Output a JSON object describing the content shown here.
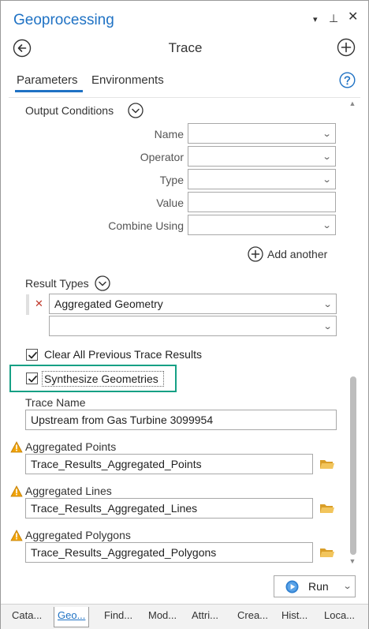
{
  "pane": {
    "title": "Geoprocessing",
    "menu_glyph": "▾",
    "pin_glyph": "⊥",
    "close_glyph": "✕"
  },
  "tool": {
    "title": "Trace"
  },
  "tabs": {
    "parameters": "Parameters",
    "environments": "Environments"
  },
  "output_conditions": {
    "label": "Output Conditions",
    "rows": {
      "name": {
        "label": "Name",
        "value": ""
      },
      "operator": {
        "label": "Operator",
        "value": ""
      },
      "type": {
        "label": "Type",
        "value": ""
      },
      "value": {
        "label": "Value",
        "value": ""
      },
      "combine_using": {
        "label": "Combine Using",
        "value": ""
      }
    },
    "add_another": "Add another"
  },
  "result_types": {
    "label": "Result Types",
    "selected": "Aggregated Geometry",
    "empty_value": ""
  },
  "checkboxes": {
    "clear_previous": {
      "label": "Clear All Previous Trace Results",
      "checked": true
    },
    "synthesize": {
      "label": "Synthesize Geometries",
      "checked": true
    }
  },
  "trace_name": {
    "label": "Trace Name",
    "value": "Upstream from Gas Turbine 3099954"
  },
  "aggregated_points": {
    "label": "Aggregated Points",
    "value": "Trace_Results_Aggregated_Points"
  },
  "aggregated_lines": {
    "label": "Aggregated Lines",
    "value": "Trace_Results_Aggregated_Lines"
  },
  "aggregated_polygons": {
    "label": "Aggregated Polygons",
    "value": "Trace_Results_Aggregated_Polygons"
  },
  "run": {
    "label": "Run"
  },
  "bottom_tabs": [
    {
      "label": "Cata..."
    },
    {
      "label": "Geo..."
    },
    {
      "label": "Find..."
    },
    {
      "label": "Mod..."
    },
    {
      "label": "Attri..."
    },
    {
      "label": "Crea..."
    },
    {
      "label": "Hist..."
    },
    {
      "label": "Loca..."
    }
  ],
  "colors": {
    "accent": "#1f72c4",
    "highlight": "#16a085",
    "warning": "#f0a30a",
    "folder": "#e8b84a"
  }
}
